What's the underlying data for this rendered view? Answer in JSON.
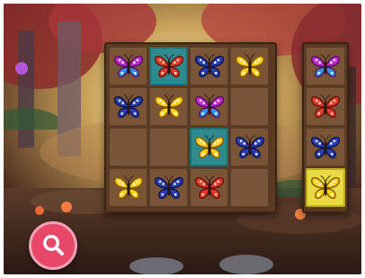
{
  "board": {
    "rows": [
      [
        {
          "butterfly": "magenta"
        },
        {
          "butterfly": "red",
          "highlight": "teal"
        },
        {
          "butterfly": "blue"
        },
        {
          "butterfly": "yellow"
        }
      ],
      [
        {
          "butterfly": "blue"
        },
        {
          "butterfly": "yellow"
        },
        {
          "butterfly": "magenta"
        },
        {
          "butterfly": null
        }
      ],
      [
        {
          "butterfly": null
        },
        {
          "butterfly": null
        },
        {
          "butterfly": "yellow",
          "highlight": "teal"
        },
        {
          "butterfly": "blue"
        }
      ],
      [
        {
          "butterfly": "yellow"
        },
        {
          "butterfly": "blue"
        },
        {
          "butterfly": "red"
        },
        {
          "butterfly": null
        }
      ]
    ]
  },
  "tray": {
    "slots": [
      {
        "butterfly": "magenta"
      },
      {
        "butterfly": "red"
      },
      {
        "butterfly": "blue"
      },
      {
        "butterfly": "yellow",
        "highlight": "yellow"
      }
    ]
  },
  "controls": {
    "zoom_icon": "magnifier-icon"
  },
  "colors": {
    "magenta": {
      "upper": "#c02ad0",
      "lower": "#2a96e6",
      "edge": "#5a0f66",
      "spot": "#ffffff"
    },
    "red": {
      "upper": "#e13b2d",
      "lower": "#e13b2d",
      "edge": "#6e120c",
      "spot": "#ffe3c8"
    },
    "blue": {
      "upper": "#2c3fb2",
      "lower": "#2c3fb2",
      "edge": "#0d1450",
      "spot": "#ffffff"
    },
    "yellow": {
      "upper": "#ffd21f",
      "lower": "#ffd21f",
      "edge": "#8a5b06",
      "spot": "#ffffff"
    },
    "zoom_button": "#e94768"
  }
}
